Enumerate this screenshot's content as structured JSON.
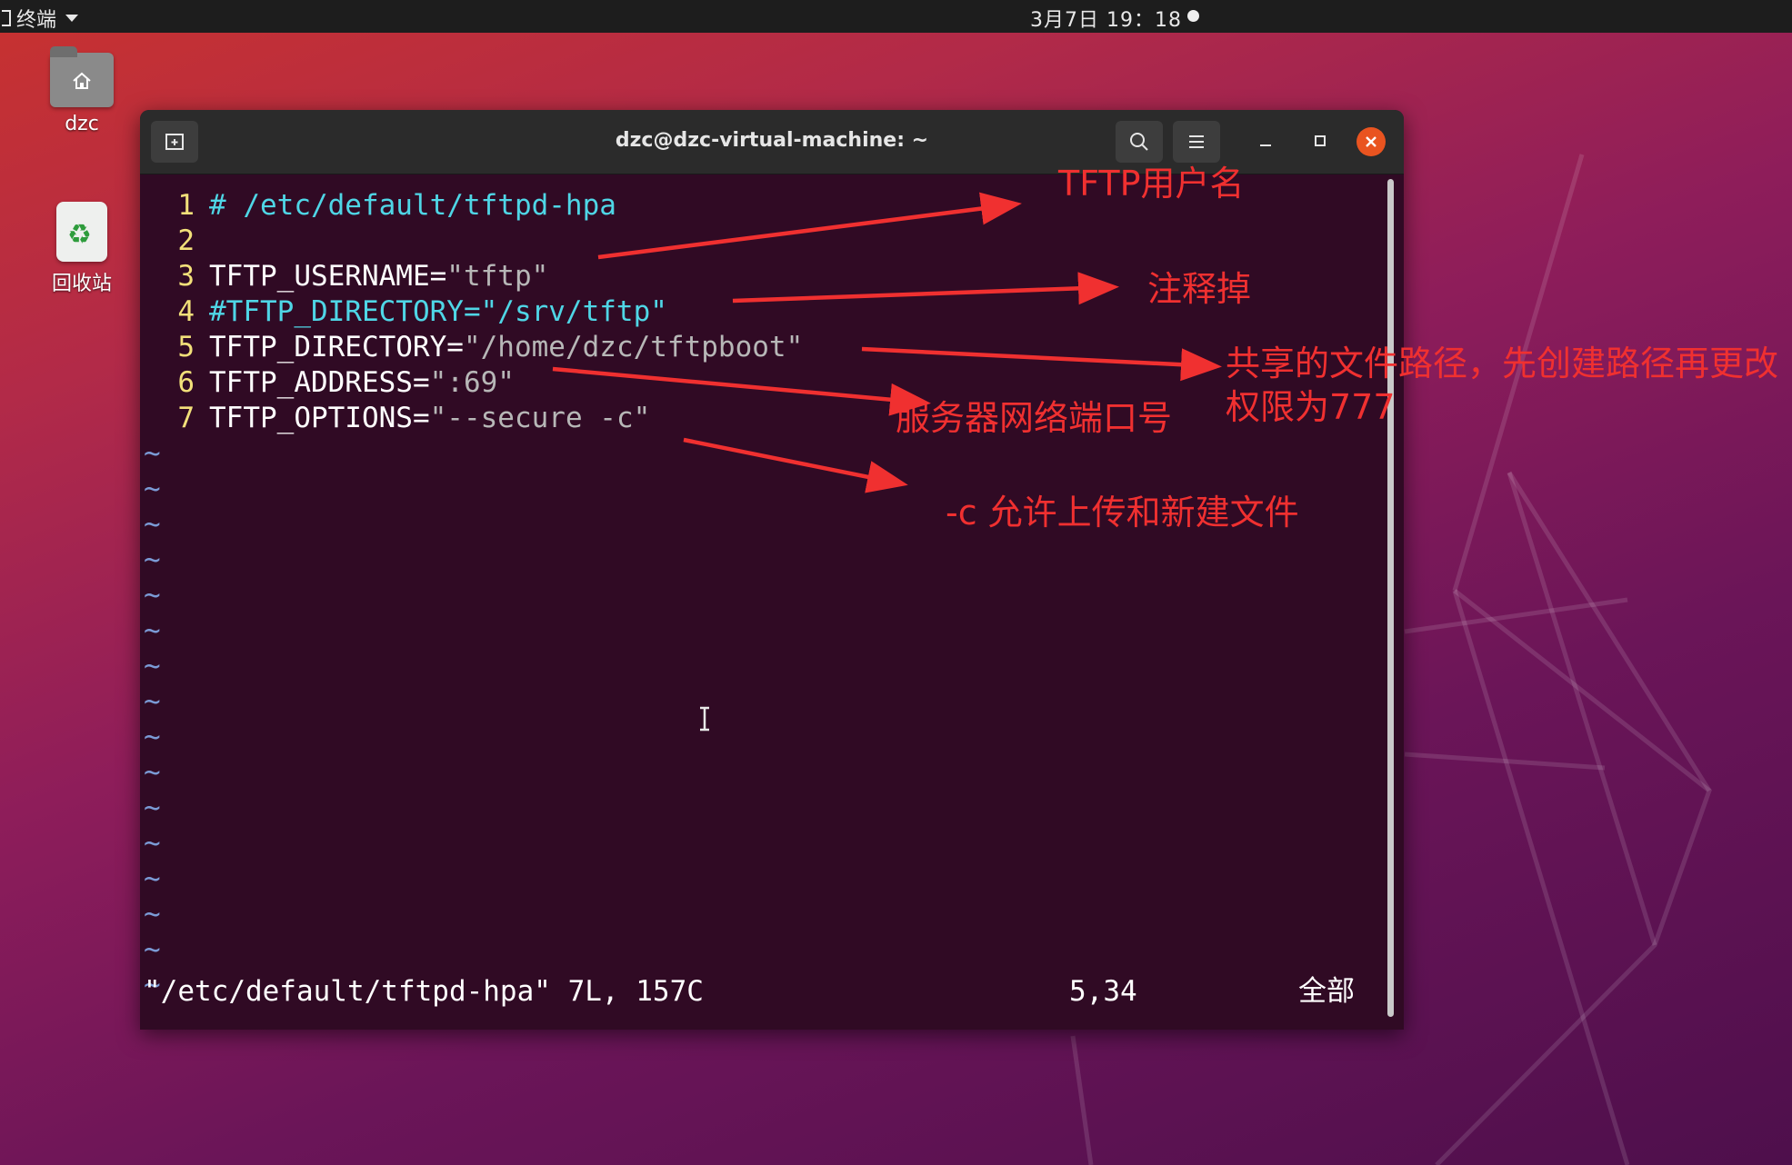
{
  "topbar": {
    "app_name": "终端",
    "clock": "3月7日 19：18"
  },
  "desktop": {
    "home_folder_label": "dzc",
    "trash_label": "回收站"
  },
  "terminal": {
    "title": "dzc@dzc-virtual-machine: ~",
    "lines": [
      {
        "num": "1",
        "segments": [
          {
            "text": "# /etc/default/tftpd-hpa",
            "kind": "comment"
          }
        ]
      },
      {
        "num": "2",
        "segments": []
      },
      {
        "num": "3",
        "segments": [
          {
            "text": "TFTP_USERNAME=",
            "kind": "key"
          },
          {
            "text": "\"tftp\"",
            "kind": "string"
          }
        ]
      },
      {
        "num": "4",
        "segments": [
          {
            "text": "#TFTP_DIRECTORY=\"/srv/tftp\"",
            "kind": "comment"
          }
        ]
      },
      {
        "num": "5",
        "segments": [
          {
            "text": "TFTP_DIRECTORY=",
            "kind": "key"
          },
          {
            "text": "\"/home/dzc/tftpboot\"",
            "kind": "string"
          }
        ]
      },
      {
        "num": "6",
        "segments": [
          {
            "text": "TFTP_ADDRESS=",
            "kind": "key"
          },
          {
            "text": "\":69\"",
            "kind": "string"
          }
        ]
      },
      {
        "num": "7",
        "segments": [
          {
            "text": "TFTP_OPTIONS=",
            "kind": "key"
          },
          {
            "text": "\"--secure -c\"",
            "kind": "string"
          }
        ]
      }
    ],
    "tilde_count": 16,
    "tilde_char": "~",
    "status_file": "\"/etc/default/tftpd-hpa\" 7L, 157C",
    "status_position": "5,34",
    "status_percent": "全部"
  },
  "annotations": {
    "color": "#f03030",
    "username_note": "TFTP用户名",
    "comment_note": "注释掉",
    "directory_note_line1": "共享的文件路径，先创建路径再更改",
    "directory_note_line2": "权限为777",
    "address_note": "服务器网络端口号",
    "options_note": "-c 允许上传和新建文件"
  },
  "colors": {
    "terminal_bg": "#300a24",
    "line_number": "#f2e07a",
    "comment": "#4fd6e6",
    "string": "#b7b7b7",
    "close_button": "#e95420"
  }
}
